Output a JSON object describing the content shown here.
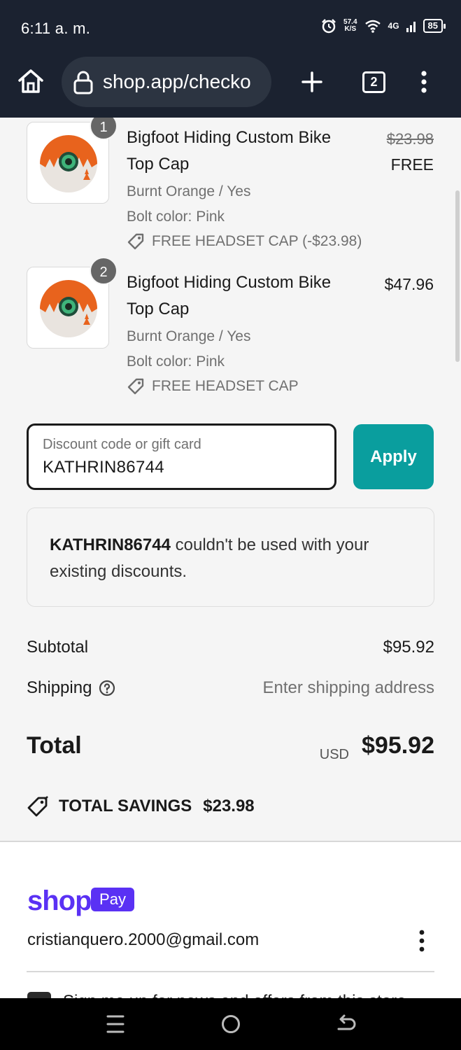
{
  "status_bar": {
    "time": "6:11 a. m.",
    "net_speed": "57.4",
    "net_unit": "K/S",
    "network": "4G",
    "battery": "85"
  },
  "browser": {
    "url": "shop.app/checko",
    "tab_count": "2"
  },
  "line_items": [
    {
      "qty": "1",
      "title": "Bigfoot Hiding Custom Bike Top Cap",
      "variant": "Burnt Orange / Yes",
      "bolt": "Bolt color: Pink",
      "discount": "FREE HEADSET CAP (-$23.98)",
      "price_original": "$23.98",
      "price": "FREE"
    },
    {
      "qty": "2",
      "title": "Bigfoot Hiding Custom Bike Top Cap",
      "variant": "Burnt Orange / Yes",
      "bolt": "Bolt color: Pink",
      "discount": "FREE HEADSET CAP",
      "price": "$47.96"
    }
  ],
  "discount_form": {
    "label": "Discount code or gift card",
    "value": "KATHRIN86744",
    "apply_label": "Apply"
  },
  "error": {
    "code": "KATHRIN86744",
    "message": " couldn't be used with your existing discounts."
  },
  "summary": {
    "subtotal_label": "Subtotal",
    "subtotal_value": "$95.92",
    "shipping_label": "Shipping",
    "shipping_value": "Enter shipping address",
    "total_label": "Total",
    "currency": "USD",
    "total_value": "$95.92",
    "savings_label": "TOTAL SAVINGS",
    "savings_value": "$23.98"
  },
  "shop_pay": {
    "logo_text": "shop",
    "badge": "Pay",
    "email": "cristianquero.2000@gmail.com",
    "partial_text": "Sign me up for news and offers from this store"
  },
  "colors": {
    "accent": "#0a9e9e",
    "shop_pay": "#5a31f4",
    "chrome": "#1b2230"
  }
}
